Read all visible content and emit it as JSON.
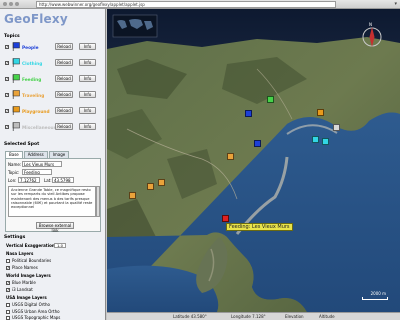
{
  "browser": {
    "url": "http://www.webwinner.org/geoflexy/applet/applet.jsp"
  },
  "app": {
    "logo": "GeoFlexy"
  },
  "topics": {
    "section_label": "Topics",
    "reload_label": "Reload",
    "info_label": "Info",
    "items": [
      {
        "name": "People",
        "color": "#1c3fd8"
      },
      {
        "name": "Clothing",
        "color": "#32d6e4"
      },
      {
        "name": "Feeding",
        "color": "#46d24a"
      },
      {
        "name": "Traveling",
        "color": "#e9a23a"
      },
      {
        "name": "Playground",
        "color": "#e89a1c"
      },
      {
        "name": "Miscellaneous",
        "color": "#bdbdbd"
      }
    ]
  },
  "selected_spot": {
    "section_label": "Selected Spot",
    "tabs": [
      "Base",
      "Address",
      "Image"
    ],
    "name_label": "Name:",
    "name_value": "Les Vieux Murs",
    "topic_label": "Topic:",
    "topic_value": "Feeding",
    "lon_label": "Lon:",
    "lon_value": "7.12762",
    "lat_label": "Lat:",
    "lat_value": "43.5798",
    "description": "Ancienne Grande Table, ce magnifique resto sur les remparts du vieil Antibes propose maintenant des menus à des tarifs presque raisonnable (60€) et pourtant la qualité reste exceptionnel",
    "browse_label": "Browse external link"
  },
  "settings": {
    "section_label": "Settings",
    "vertical_exaggeration_label": "Vertical Exaggeration",
    "vertical_exaggeration_value": "1.0",
    "nasa_layers_label": "Nasa Layers",
    "political_boundaries": "Political Boundaries",
    "place_names": "Place Names",
    "world_image_layers_label": "World Image Layers",
    "blue_marble": "Blue Marble",
    "i3_landsat": "i3 Landsat",
    "usa_image_layers_label": "USA Image Layers",
    "usgs_digital_ortho": "USGS Digital Ortho",
    "usgs_urban_area_ortho": "USGS Urban Area Ortho",
    "usgs_topographic_maps": "USGS Topographic Maps"
  },
  "map": {
    "callout_text": "Feeding: Les Vieux Murs",
    "scale_text": "2000 m",
    "compass_letter": "N"
  },
  "status_bar": {
    "latitude": "Latitude 43.580°",
    "longitude": "Longitude 7.128°",
    "elevation": "Elevation",
    "altitude": "Altitude"
  }
}
